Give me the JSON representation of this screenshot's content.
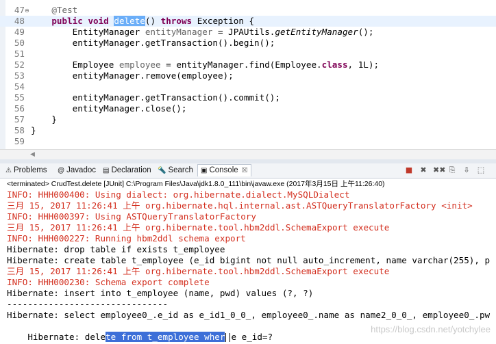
{
  "editor": {
    "lines": [
      {
        "num": "47",
        "fold": true,
        "segments": [
          {
            "t": "    "
          },
          {
            "t": "@Test",
            "c": "an"
          }
        ]
      },
      {
        "num": "48",
        "current": true,
        "segments": [
          {
            "t": "    "
          },
          {
            "t": "public",
            "c": "kw"
          },
          {
            "t": " "
          },
          {
            "t": "void",
            "c": "kw"
          },
          {
            "t": " "
          },
          {
            "t": "delete",
            "c": "sel"
          },
          {
            "t": "() "
          },
          {
            "t": "throws",
            "c": "kw"
          },
          {
            "t": " Exception {"
          }
        ]
      },
      {
        "num": "49",
        "segments": [
          {
            "t": "        EntityManager "
          },
          {
            "t": "entityManager",
            "c": "an"
          },
          {
            "t": " = JPAUtils."
          },
          {
            "t": "getEntityManager",
            "c": "it"
          },
          {
            "t": "();"
          }
        ]
      },
      {
        "num": "50",
        "segments": [
          {
            "t": "        entityManager.getTransaction().begin();"
          }
        ]
      },
      {
        "num": "51",
        "segments": [
          {
            "t": ""
          }
        ]
      },
      {
        "num": "52",
        "segments": [
          {
            "t": "        Employee "
          },
          {
            "t": "employee",
            "c": "an"
          },
          {
            "t": " = entityManager.find(Employee."
          },
          {
            "t": "class",
            "c": "kw"
          },
          {
            "t": ", 1L);"
          }
        ]
      },
      {
        "num": "53",
        "segments": [
          {
            "t": "        entityManager.remove(employee);"
          }
        ]
      },
      {
        "num": "54",
        "segments": [
          {
            "t": ""
          }
        ]
      },
      {
        "num": "55",
        "segments": [
          {
            "t": "        entityManager.getTransaction().commit();"
          }
        ]
      },
      {
        "num": "56",
        "segments": [
          {
            "t": "        entityManager.close();"
          }
        ]
      },
      {
        "num": "57",
        "segments": [
          {
            "t": "    }"
          }
        ]
      },
      {
        "num": "58",
        "segments": [
          {
            "t": "}"
          }
        ]
      },
      {
        "num": "59",
        "segments": [
          {
            "t": ""
          }
        ]
      }
    ]
  },
  "views": {
    "tabs": [
      {
        "label": "Problems",
        "icon": "problems-icon",
        "glyph": "⚠",
        "active": false
      },
      {
        "label": "Javadoc",
        "icon": "javadoc-icon",
        "glyph": "@",
        "active": false
      },
      {
        "label": "Declaration",
        "icon": "declaration-icon",
        "glyph": "▤",
        "active": false
      },
      {
        "label": "Search",
        "icon": "search-icon",
        "glyph": "🔦",
        "active": false
      },
      {
        "label": "Console",
        "icon": "console-icon",
        "glyph": "▣",
        "active": true
      }
    ],
    "close_glyph": "☒",
    "toolbar": [
      {
        "name": "terminate-icon",
        "glyph": "■",
        "color": "#c0392b"
      },
      {
        "name": "remove-launch-icon",
        "glyph": "✖",
        "color": "#555555"
      },
      {
        "name": "remove-all-launches-icon",
        "glyph": "✖✖",
        "color": "#555555"
      },
      {
        "name": "clear-console-icon",
        "glyph": "⎘",
        "color": "#555555"
      },
      {
        "name": "scroll-lock-icon",
        "glyph": "⇩",
        "color": "#555555"
      },
      {
        "name": "pin-console-icon",
        "glyph": "⬚",
        "color": "#555555"
      }
    ]
  },
  "console": {
    "terminated": "<terminated> CrudTest.delete [JUnit] C:\\Program Files\\Java\\jdk1.8.0_111\\bin\\javaw.exe (2017年3月15日 上午11:26:40)",
    "lines": [
      {
        "kind": "err",
        "text": "INFO: HHH000400: Using dialect: org.hibernate.dialect.MySQLDialect"
      },
      {
        "kind": "err",
        "text": "三月 15, 2017 11:26:41 上午 org.hibernate.hql.internal.ast.ASTQueryTranslatorFactory <init>"
      },
      {
        "kind": "err",
        "text": "INFO: HHH000397: Using ASTQueryTranslatorFactory"
      },
      {
        "kind": "err",
        "text": "三月 15, 2017 11:26:41 上午 org.hibernate.tool.hbm2ddl.SchemaExport execute"
      },
      {
        "kind": "err",
        "text": "INFO: HHH000227: Running hbm2ddl schema export"
      },
      {
        "kind": "out",
        "text": "Hibernate: drop table if exists t_employee"
      },
      {
        "kind": "out",
        "text": "Hibernate: create table t_employee (e_id bigint not null auto_increment, name varchar(255), p"
      },
      {
        "kind": "err",
        "text": "三月 15, 2017 11:26:41 上午 org.hibernate.tool.hbm2ddl.SchemaExport execute"
      },
      {
        "kind": "err",
        "text": "INFO: HHH000230: Schema export complete"
      },
      {
        "kind": "out",
        "text": "Hibernate: insert into t_employee (name, pwd) values (?, ?)"
      },
      {
        "kind": "out",
        "text": "-------------------------------"
      },
      {
        "kind": "out",
        "text": "Hibernate: select employee0_.e_id as e_id1_0_0_, employee0_.name as name2_0_0_, employee0_.pw"
      }
    ],
    "last_line": {
      "before": "Hibernate: dele",
      "selected": "te from t_employee wher",
      "after": "e e_id=?"
    },
    "watermark": "https://blog.csdn.net/yotchylee"
  }
}
